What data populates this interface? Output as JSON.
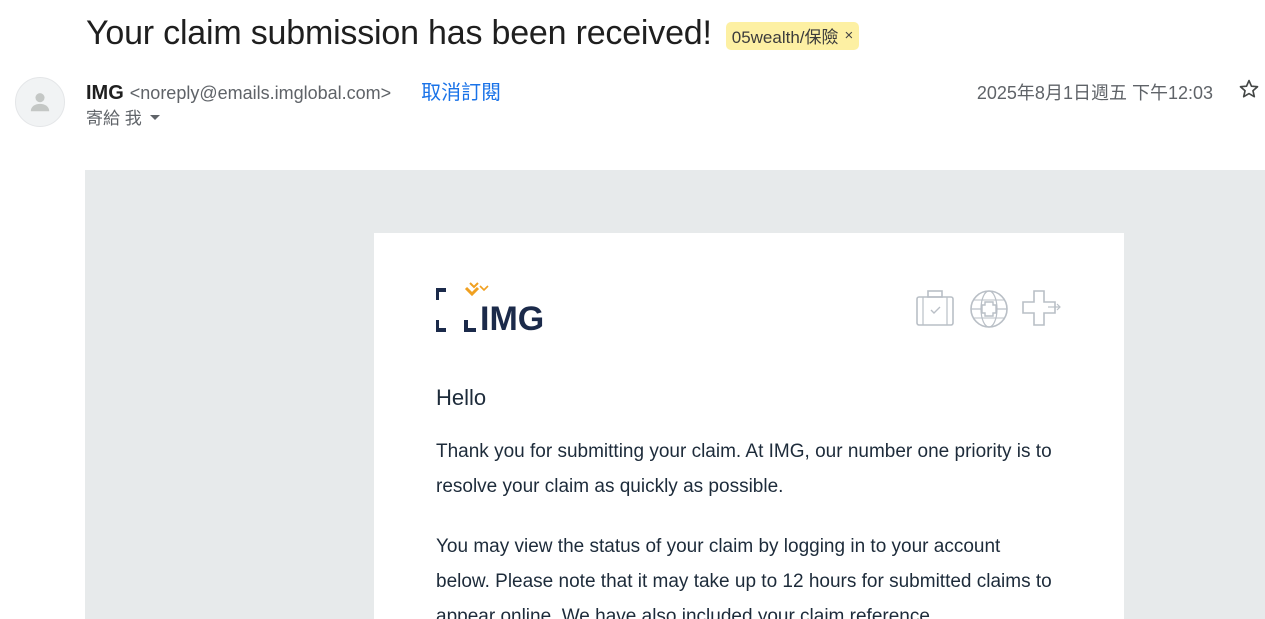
{
  "email": {
    "subject": "Your claim submission has been received!",
    "label": "05wealth/保險",
    "label_remove": "×",
    "sender_name": "IMG",
    "sender_email": "<noreply@emails.imglobal.com>",
    "unsubscribe": "取消訂閱",
    "to_line": "寄給 我",
    "date": "2025年8月1日週五 下午12:03"
  },
  "body": {
    "greeting": "Hello",
    "paragraph1": "Thank you for submitting your claim. At IMG, our number one priority is to resolve your claim as quickly as possible.",
    "paragraph2": "You may view the status of your claim by logging in to your account below. Please note that it may take up to 12 hours for submitted claims to appear online. We have also included your claim reference"
  },
  "logo": {
    "text": "IMG"
  },
  "icons": [
    "suitcase-icon",
    "globe-cross-icon",
    "medical-cross-icon",
    "star-icon",
    "person-icon",
    "dropdown-caret-icon"
  ],
  "colors": {
    "link": "#1a73e8",
    "label_bg": "#fdf0a3",
    "logo_navy": "#1b2a4a",
    "logo_orange": "#f0a020",
    "email_bg": "#e7eaeb",
    "body_text": "#1d2b3a"
  }
}
